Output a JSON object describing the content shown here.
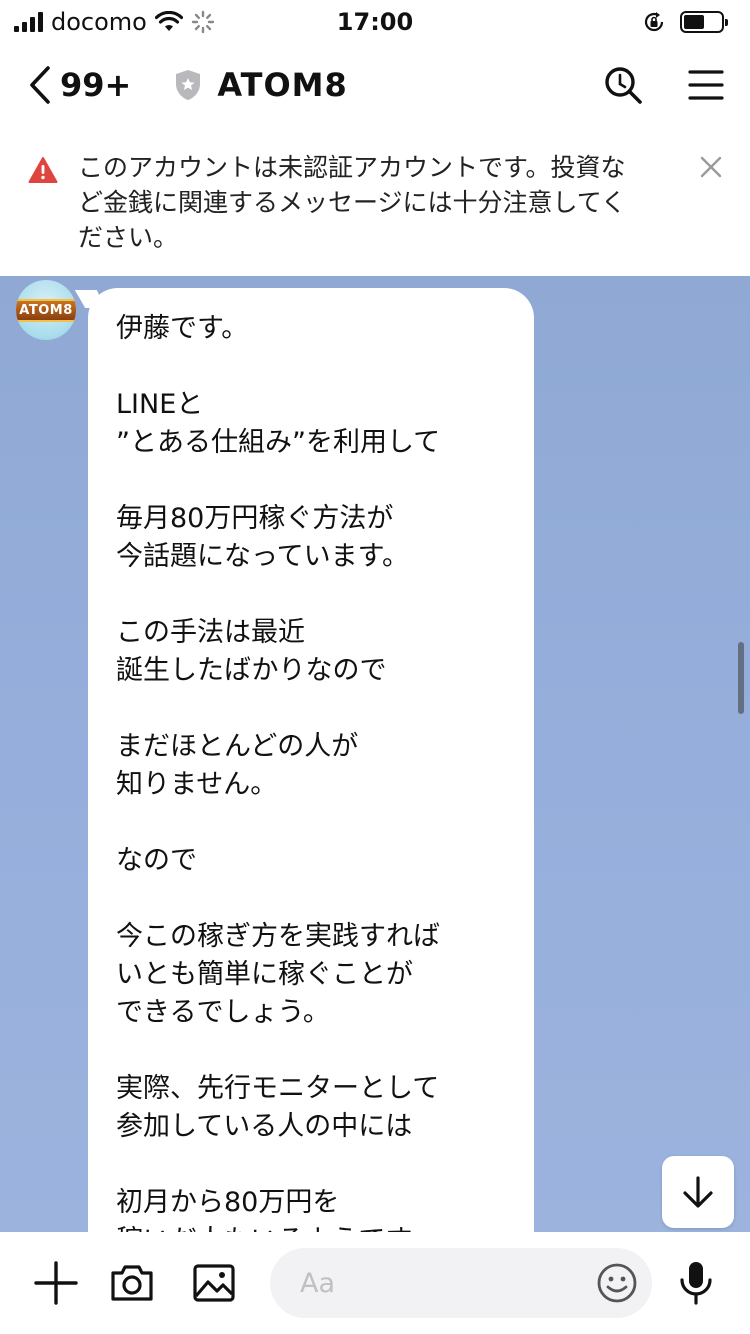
{
  "status_bar": {
    "carrier": "docomo",
    "time": "17:00"
  },
  "header": {
    "back_count": "99+",
    "title": "ATOM8"
  },
  "warning": {
    "lines": [
      "このアカウントは未認証アカウントです。投資な",
      "ど金銭に関連するメッセージには十分注意してく",
      "ださい。"
    ]
  },
  "avatar": {
    "logo_text": "ATOM8"
  },
  "message": {
    "lines": [
      "伊藤です。",
      "",
      "LINEと",
      "”とある仕組み”を利用して",
      "",
      "毎月80万円稼ぐ方法が",
      "今話題になっています。",
      "",
      "この手法は最近",
      "誕生したばかりなので",
      "",
      "まだほとんどの人が",
      "知りません。",
      "",
      "なので",
      "",
      "今この稼ぎ方を実践すれば",
      "いとも簡単に稼ぐことが",
      "できるでしょう。",
      "",
      "実際、先行モニターとして",
      "参加している人の中には",
      "",
      "初月から80万円を",
      "稼いだ人もいるようです。"
    ]
  },
  "input": {
    "placeholder": "Aa"
  },
  "colors": {
    "chat_background": "#93acd8",
    "warning_icon": "#e0443e",
    "bubble": "#ffffff"
  }
}
